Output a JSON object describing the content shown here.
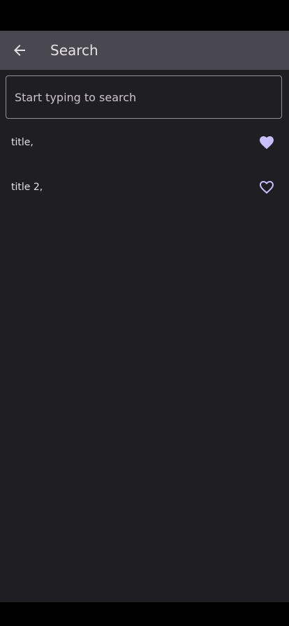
{
  "app_bar": {
    "title": "Search",
    "back_icon": "arrow-left-icon"
  },
  "search": {
    "placeholder": "Start typing to search",
    "value": ""
  },
  "results": [
    {
      "title": "title,",
      "favorite": true,
      "icon": "heart-filled-icon"
    },
    {
      "title": "title 2,",
      "favorite": false,
      "icon": "heart-outline-icon"
    }
  ],
  "colors": {
    "background": "#1f1f23",
    "app_bar": "#49474f",
    "accent": "#c9beff",
    "text": "#e6e1e5",
    "outline": "#938f99"
  }
}
